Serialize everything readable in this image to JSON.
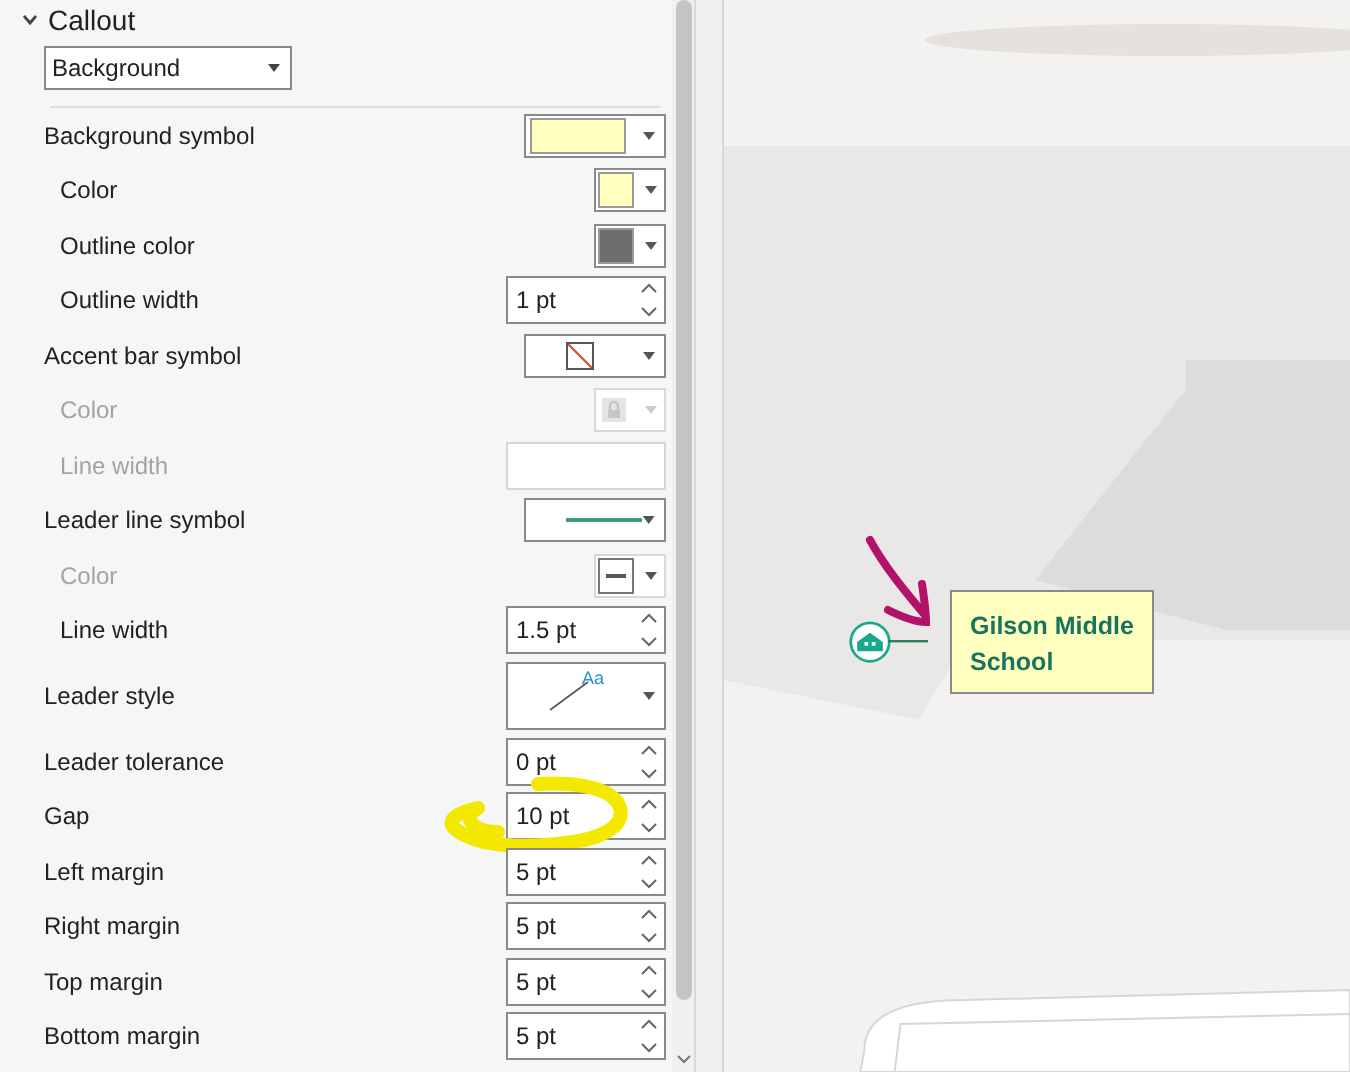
{
  "section": {
    "title": "Callout",
    "expanded": true,
    "type_dropdown": "Background"
  },
  "rows": [
    {
      "label": "Background symbol",
      "indent": false,
      "disabled": false,
      "kind": "swatch",
      "color": "#ffffc0"
    },
    {
      "label": "Color",
      "indent": true,
      "disabled": false,
      "kind": "color",
      "color": "#ffffc0"
    },
    {
      "label": "Outline color",
      "indent": true,
      "disabled": false,
      "kind": "color",
      "color": "#6e6e6e"
    },
    {
      "label": "Outline width",
      "indent": true,
      "disabled": false,
      "kind": "spin",
      "value": "1 pt"
    },
    {
      "label": "Accent bar symbol",
      "indent": false,
      "disabled": false,
      "kind": "nosymbol"
    },
    {
      "label": "Color",
      "indent": true,
      "disabled": true,
      "kind": "locked"
    },
    {
      "label": "Line width",
      "indent": true,
      "disabled": true,
      "kind": "empty"
    },
    {
      "label": "Leader line symbol",
      "indent": false,
      "disabled": false,
      "kind": "line",
      "color": "#3a9a76"
    },
    {
      "label": "Color",
      "indent": true,
      "disabled": true,
      "kind": "dash"
    },
    {
      "label": "Line width",
      "indent": true,
      "disabled": false,
      "kind": "spin",
      "value": "1.5 pt"
    },
    {
      "label": "Leader style",
      "indent": false,
      "disabled": false,
      "kind": "leader",
      "value": "Aa"
    },
    {
      "label": "Leader tolerance",
      "indent": false,
      "disabled": false,
      "kind": "spin",
      "value": "0 pt"
    },
    {
      "label": "Gap",
      "indent": false,
      "disabled": false,
      "kind": "spin",
      "value": "10 pt",
      "highlighted": true
    },
    {
      "label": "Left margin",
      "indent": false,
      "disabled": false,
      "kind": "spin",
      "value": "5 pt"
    },
    {
      "label": "Right margin",
      "indent": false,
      "disabled": false,
      "kind": "spin",
      "value": "5 pt"
    },
    {
      "label": "Top margin",
      "indent": false,
      "disabled": false,
      "kind": "spin",
      "value": "5 pt"
    },
    {
      "label": "Bottom margin",
      "indent": false,
      "disabled": false,
      "kind": "spin",
      "value": "5 pt"
    }
  ],
  "map": {
    "callout_label": "Gilson Middle School"
  }
}
